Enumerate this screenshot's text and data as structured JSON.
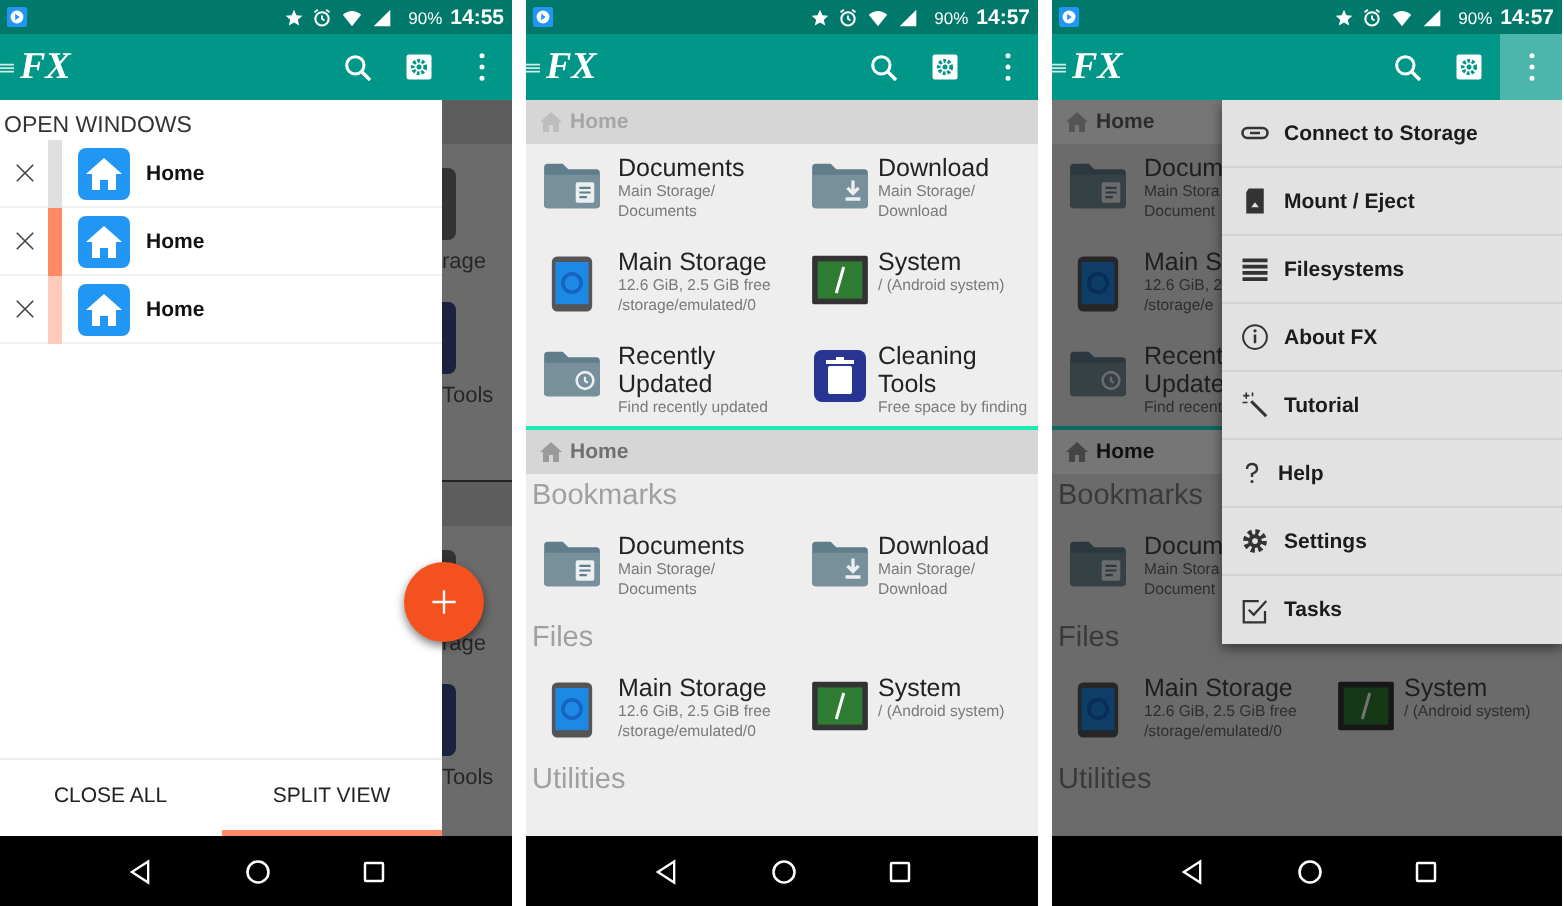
{
  "screens": [
    {
      "kind": "windows",
      "status_bar": {
        "battery": "90%",
        "time": "14:55"
      },
      "toolbar": {
        "logo": "FX",
        "overflow_pressed": false
      },
      "background": {
        "panes": [
          {
            "fragments": [
              {
                "kind": "storage",
                "label": "rage"
              },
              {
                "kind": "cleaning",
                "label": "Tools"
              }
            ]
          },
          {
            "fragments": [
              {
                "kind": "storage",
                "label": "rage"
              },
              {
                "kind": "cleaning",
                "label": "Tools"
              }
            ]
          }
        ]
      },
      "drawer": {
        "title": "OPEN WINDOWS",
        "windows": [
          {
            "label": "Home",
            "color": "#e0e0e0"
          },
          {
            "label": "Home",
            "color": "#ff8a65"
          },
          {
            "label": "Home",
            "color": "#ffccbc"
          }
        ],
        "buttons": [
          {
            "label": "CLOSE ALL",
            "selected": false
          },
          {
            "label": "SPLIT VIEW",
            "selected": true
          }
        ]
      }
    },
    {
      "kind": "browser",
      "status_bar": {
        "battery": "90%",
        "time": "14:57"
      },
      "toolbar": {
        "logo": "FX",
        "overflow_pressed": false
      },
      "panes": [
        {
          "breadcrumb": "Home",
          "active": false,
          "sections": [
            {
              "kind": "grid",
              "rows": [
                [
                  {
                    "kind": "documents",
                    "title": "Documents",
                    "subtitle": [
                      "Main Storage/",
                      "Documents"
                    ]
                  },
                  {
                    "kind": "download",
                    "title": "Download",
                    "subtitle": [
                      "Main Storage/",
                      "Download"
                    ]
                  }
                ],
                [
                  {
                    "kind": "storage",
                    "title": "Main Storage",
                    "subtitle": [
                      "12.6 GiB, 2.5 GiB free",
                      "/storage/emulated/0"
                    ]
                  },
                  {
                    "kind": "system",
                    "title": "System",
                    "subtitle": [
                      "/ (Android system)"
                    ]
                  }
                ],
                [
                  {
                    "kind": "recent",
                    "title": "Recently Updated",
                    "subtitle": [
                      "Find recently updated"
                    ]
                  },
                  {
                    "kind": "cleaning",
                    "title": "Cleaning Tools",
                    "subtitle": [
                      "Free space by finding"
                    ]
                  }
                ]
              ]
            }
          ]
        },
        {
          "breadcrumb": "Home",
          "active": true,
          "sections": [
            {
              "kind": "heading",
              "label": "Bookmarks"
            },
            {
              "kind": "grid",
              "rows": [
                [
                  {
                    "kind": "documents",
                    "title": "Documents",
                    "subtitle": [
                      "Main Storage/",
                      "Documents"
                    ]
                  },
                  {
                    "kind": "download",
                    "title": "Download",
                    "subtitle": [
                      "Main Storage/",
                      "Download"
                    ]
                  }
                ]
              ]
            },
            {
              "kind": "heading",
              "label": "Files"
            },
            {
              "kind": "grid",
              "rows": [
                [
                  {
                    "kind": "storage",
                    "title": "Main Storage",
                    "subtitle": [
                      "12.6 GiB, 2.5 GiB free",
                      "/storage/emulated/0"
                    ]
                  },
                  {
                    "kind": "system",
                    "title": "System",
                    "subtitle": [
                      "/ (Android system)"
                    ]
                  }
                ]
              ]
            },
            {
              "kind": "heading",
              "label": "Utilities"
            }
          ]
        }
      ]
    },
    {
      "kind": "browser",
      "status_bar": {
        "battery": "90%",
        "time": "14:57"
      },
      "toolbar": {
        "logo": "FX",
        "overflow_pressed": true
      },
      "panes": [
        {
          "breadcrumb": "Home",
          "active": false,
          "sections": [
            {
              "kind": "grid",
              "rows": [
                [
                  {
                    "kind": "documents",
                    "title": "Docum",
                    "subtitle": [
                      "Main Stora",
                      "Document"
                    ]
                  }
                ],
                [
                  {
                    "kind": "storage",
                    "title": "Main S",
                    "subtitle": [
                      "12.6 GiB, 2",
                      "/storage/e"
                    ]
                  }
                ],
                [
                  {
                    "kind": "recent",
                    "title": "Recent Update",
                    "subtitle": [
                      "Find recent"
                    ]
                  }
                ]
              ]
            }
          ]
        },
        {
          "breadcrumb": "Home",
          "active": true,
          "sections": [
            {
              "kind": "heading",
              "label": "Bookmarks"
            },
            {
              "kind": "grid",
              "rows": [
                [
                  {
                    "kind": "documents",
                    "title": "Docum",
                    "subtitle": [
                      "Main Stora",
                      "Document"
                    ]
                  }
                ]
              ]
            },
            {
              "kind": "heading",
              "label": "Files"
            },
            {
              "kind": "grid",
              "rows": [
                [
                  {
                    "kind": "storage",
                    "title": "Main Storage",
                    "subtitle": [
                      "12.6 GiB, 2.5 GiB free",
                      "/storage/emulated/0"
                    ]
                  },
                  {
                    "kind": "system",
                    "title": "System",
                    "subtitle": [
                      "/ (Android system)"
                    ]
                  }
                ]
              ]
            },
            {
              "kind": "heading",
              "label": "Utilities"
            }
          ]
        }
      ],
      "menu": {
        "items": [
          {
            "kind": "connect",
            "label": "Connect to Storage"
          },
          {
            "kind": "mount",
            "label": "Mount / Eject"
          },
          {
            "kind": "filesystems",
            "label": "Filesystems"
          },
          {
            "kind": "about",
            "label": "About FX"
          },
          {
            "kind": "tutorial",
            "label": "Tutorial"
          },
          {
            "kind": "help",
            "label": "Help"
          },
          {
            "kind": "settings",
            "label": "Settings"
          },
          {
            "kind": "tasks",
            "label": "Tasks"
          }
        ]
      }
    }
  ]
}
